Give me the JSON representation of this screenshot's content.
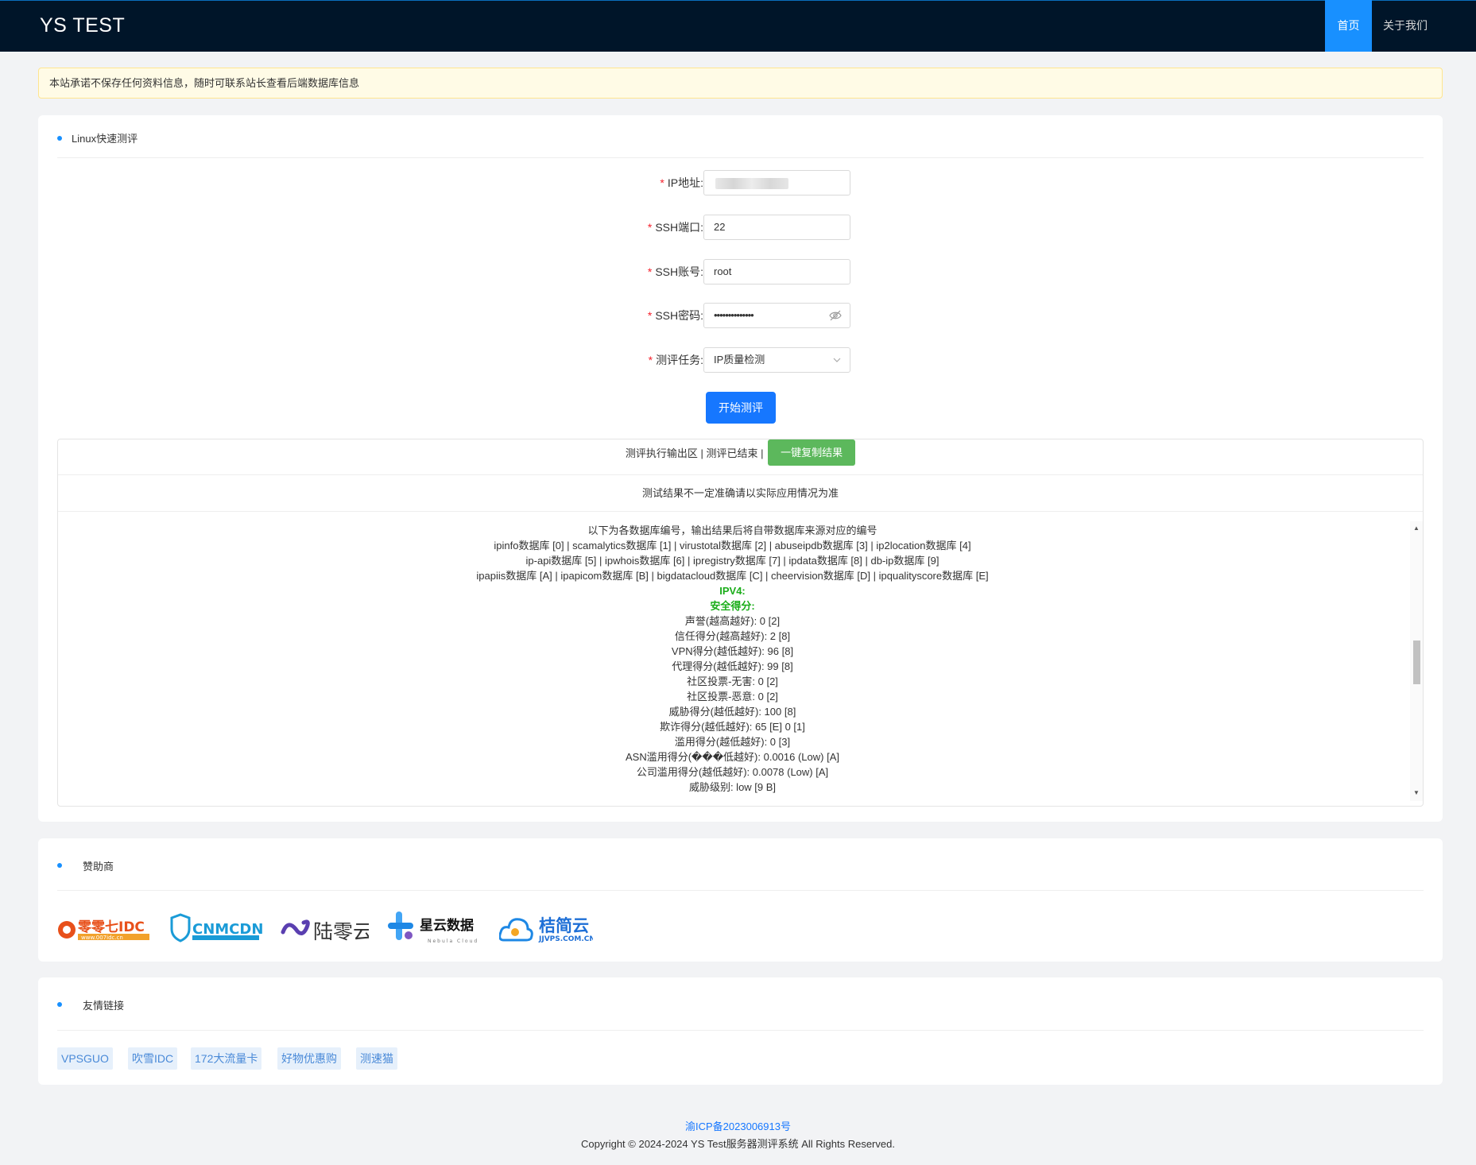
{
  "nav": {
    "brand": "YS TEST",
    "home": "首页",
    "about": "关于我们"
  },
  "alert": "本站承诺不保存任何资料信息，随时可联系站长查看后端数据库信息",
  "main": {
    "title": "Linux快速测评",
    "form": {
      "ip_label": "IP地址:",
      "port_label": "SSH端口:",
      "port_value": "22",
      "user_label": "SSH账号:",
      "user_value": "root",
      "pass_label": "SSH密码:",
      "pass_value": "••••••••••••••",
      "task_label": "测评任务:",
      "task_value": "IP质量检测",
      "start_button": "开始测评"
    },
    "output": {
      "header_text": "测评执行输出区 | 测评已结束 |",
      "copy_button": "一键复制结果",
      "note": "测试结果不一定准确请以实际应用情况为准",
      "lines": [
        "以下为各数据库编号，输出结果后将自带数据库来源对应的编号",
        "ipinfo数据库 [0] | scamalytics数据库 [1] | virustotal数据库 [2] | abuseipdb数据库 [3] | ip2location数据库 [4]",
        "ip-api数据库 [5] | ipwhois数据库 [6] | ipregistry数据库 [7] | ipdata数据库 [8] | db-ip数据库 [9]",
        "ipapiis数据库 [A] | ipapicom数据库 [B] | bigdatacloud数据库 [C] | cheervision数据库 [D] | ipqualityscore数据库 [E]",
        "IPV4:",
        "安全得分:",
        "声誉(越高越好): 0 [2]",
        "信任得分(越高越好): 2 [8]",
        "VPN得分(越低越好): 96 [8]",
        "代理得分(越低越好): 99 [8]",
        "社区投票-无害: 0 [2]",
        "社区投票-恶意: 0 [2]",
        "威胁得分(越低越好): 100 [8]",
        "欺诈得分(越低越好): 65 [E] 0 [1]",
        "滥用得分(越低越好): 0 [3]",
        "ASN滥用得分(���低越好): 0.0016 (Low) [A]",
        "公司滥用得分(越低越好): 0.0078 (Low) [A]",
        "威胁级别: low [9 B]"
      ]
    }
  },
  "sponsors": {
    "title": "赞助商",
    "logos": [
      {
        "name": "零零七IDC",
        "sub": "www.007idc.cn",
        "color": "#e8501a"
      },
      {
        "name": "CNMCDN",
        "color": "#1a9bd7"
      },
      {
        "name": "陆零云",
        "color": "#3a2f7a"
      },
      {
        "name": "星云数据",
        "sub": "Nebula Cloud",
        "color": "#1e88e5"
      },
      {
        "name": "桔简云",
        "sub": "JJVPS.COM.CN",
        "color": "#1565c0"
      }
    ]
  },
  "links": {
    "title": "友情链接",
    "items": [
      "VPSGUO",
      "吹雪IDC",
      "172大流量卡",
      "好物优惠购",
      "测速猫"
    ]
  },
  "footer": {
    "icp": "渝ICP备2023006913号",
    "copyright": "Copyright © 2024-2024 YS Test服务器测评系统 All Rights Reserved."
  }
}
